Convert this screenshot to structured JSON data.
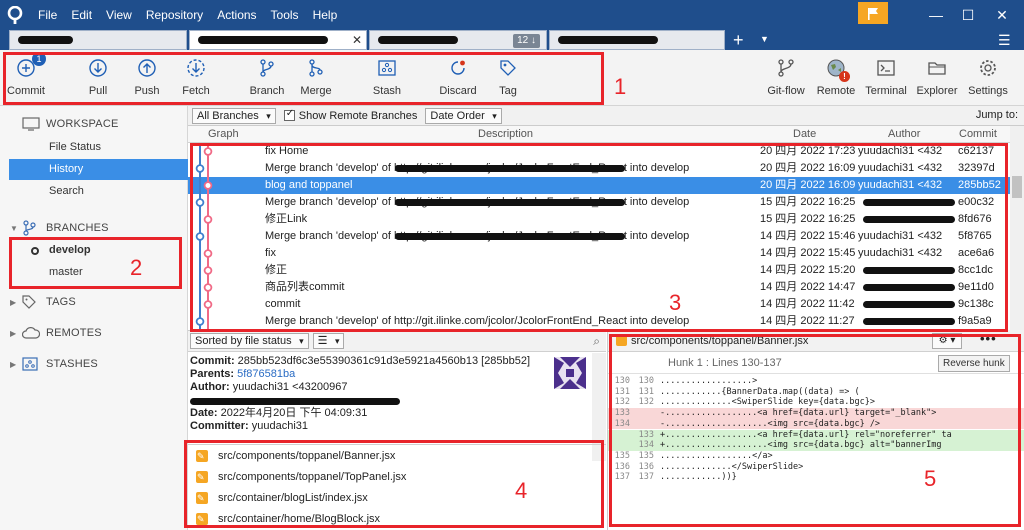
{
  "menu": [
    "File",
    "Edit",
    "View",
    "Repository",
    "Actions",
    "Tools",
    "Help"
  ],
  "tabs": [
    {
      "label": ""
    },
    {
      "label": ""
    },
    {
      "label": "",
      "badge": "12 ↓"
    },
    {
      "label": ""
    }
  ],
  "toolbar": {
    "commit": {
      "label": "Commit",
      "badge": "1"
    },
    "pull": "Pull",
    "push": "Push",
    "fetch": "Fetch",
    "branch": "Branch",
    "merge": "Merge",
    "stash": "Stash",
    "discard": "Discard",
    "tag": "Tag",
    "gitflow": "Git-flow",
    "remote": {
      "label": "Remote",
      "badge": "!"
    },
    "terminal": "Terminal",
    "explorer": "Explorer",
    "settings": "Settings"
  },
  "annotations": [
    "1",
    "2",
    "3",
    "4",
    "5"
  ],
  "sidebar": {
    "workspace": {
      "title": "WORKSPACE",
      "items": [
        "File Status",
        "History",
        "Search"
      ],
      "selected": "History"
    },
    "branches": {
      "title": "BRANCHES",
      "items": [
        "develop",
        "master"
      ],
      "current": "develop"
    },
    "tags": "TAGS",
    "remotes": "REMOTES",
    "stashes": "STASHES"
  },
  "history": {
    "filter": "All Branches",
    "show_remote": "Show Remote Branches",
    "order": "Date Order",
    "jump_to": "Jump to:",
    "columns": [
      "Graph",
      "Description",
      "Date",
      "Author",
      "Commit"
    ],
    "rows": [
      {
        "desc": "fix Home",
        "date": "20 四月 2022 17:23",
        "author": "yuudachi31 <432",
        "hash": "c62137"
      },
      {
        "desc": "Merge branch 'develop' of http://git.ilinke.com/jcolor/JcolorFrontEnd_React into develop",
        "date": "20 四月 2022 16:09",
        "author": "yuudachi31 <432",
        "hash": "32397d"
      },
      {
        "desc": "blog and toppanel",
        "date": "20 四月 2022 16:09",
        "author": "yuudachi31 <432",
        "hash": "285bb52"
      },
      {
        "desc": "Merge branch 'develop' of http://git.ilinke.com/jcolor/JcolorFrontEnd_React into develop",
        "date": "15 四月 2022 16:25",
        "author": "",
        "hash": "e00c32"
      },
      {
        "desc": "修正Link",
        "date": "15 四月 2022 16:25",
        "author": "",
        "hash": "8fd676"
      },
      {
        "desc": "Merge branch 'develop' of http://git.ilinke.com/jcolor/JcolorFrontEnd_React into develop",
        "date": "14 四月 2022 15:46",
        "author": "yuudachi31 <432",
        "hash": "5f8765"
      },
      {
        "desc": "fix",
        "date": "14 四月 2022 15:45",
        "author": "yuudachi31 <432",
        "hash": "ace6a6"
      },
      {
        "desc": "修正",
        "date": "14 四月 2022 15:20",
        "author": "",
        "hash": "8cc1dc"
      },
      {
        "desc": "商品列表commit",
        "date": "14 四月 2022 14:47",
        "author": "",
        "hash": "9e11d0"
      },
      {
        "desc": "commit",
        "date": "14 四月 2022 11:42",
        "author": "",
        "hash": "9c138c"
      },
      {
        "desc": "Merge branch 'develop' of http://git.ilinke.com/jcolor/JcolorFrontEnd_React into develop",
        "date": "14 四月 2022 11:27",
        "author": "",
        "hash": "f9a5a9"
      }
    ]
  },
  "details": {
    "sort": "Sorted by file status",
    "view": "☰",
    "commit_label": "Commit:",
    "commit_value": "285bb523df6c3e55390361c91d3e5921a4560b13 [285bb52]",
    "parents_label": "Parents:",
    "parents_value": "5f876581ba",
    "author_label": "Author:",
    "author_value": "yuudachi31 <43200967",
    "date_label": "Date:",
    "date_value": "2022年4月20日 下午 04:09:31",
    "committer_label": "Committer:",
    "committer_value": "yuudachi31",
    "files": [
      "src/components/toppanel/Banner.jsx",
      "src/components/toppanel/TopPanel.jsx",
      "src/container/blogList/index.jsx",
      "src/container/home/BlogBlock.jsx"
    ]
  },
  "diff": {
    "file": "src/components/toppanel/Banner.jsx",
    "hunk": "Hunk 1 : Lines 130-137",
    "reverse_hunk": "Reverse hunk",
    "lines": [
      {
        "a": "130",
        "b": "130",
        "type": "ctx",
        "code": "..................>"
      },
      {
        "a": "131",
        "b": "131",
        "type": "ctx",
        "code": "............{BannerData.map((data) => ("
      },
      {
        "a": "132",
        "b": "132",
        "type": "ctx",
        "code": "..............<SwiperSlide key={data.bgc}>"
      },
      {
        "a": "133",
        "b": "",
        "type": "del",
        "code": "-..................<a href={data.url} target=\"_blank\">"
      },
      {
        "a": "134",
        "b": "",
        "type": "del",
        "code": "-....................<img src={data.bgc} />"
      },
      {
        "a": "",
        "b": "133",
        "type": "add",
        "code": "+..................<a href={data.url} rel=\"noreferrer\" ta"
      },
      {
        "a": "",
        "b": "134",
        "type": "add",
        "code": "+....................<img src={data.bgc} alt=\"bannerImg"
      },
      {
        "a": "135",
        "b": "135",
        "type": "ctx",
        "code": "..................</a>"
      },
      {
        "a": "136",
        "b": "136",
        "type": "ctx",
        "code": "..............</SwiperSlide>"
      },
      {
        "a": "137",
        "b": "137",
        "type": "ctx",
        "code": "............))}"
      }
    ]
  },
  "colors": {
    "accent": "#3a8ee6",
    "titlebar": "#1f4e8c",
    "annotation": "#e8242a"
  }
}
